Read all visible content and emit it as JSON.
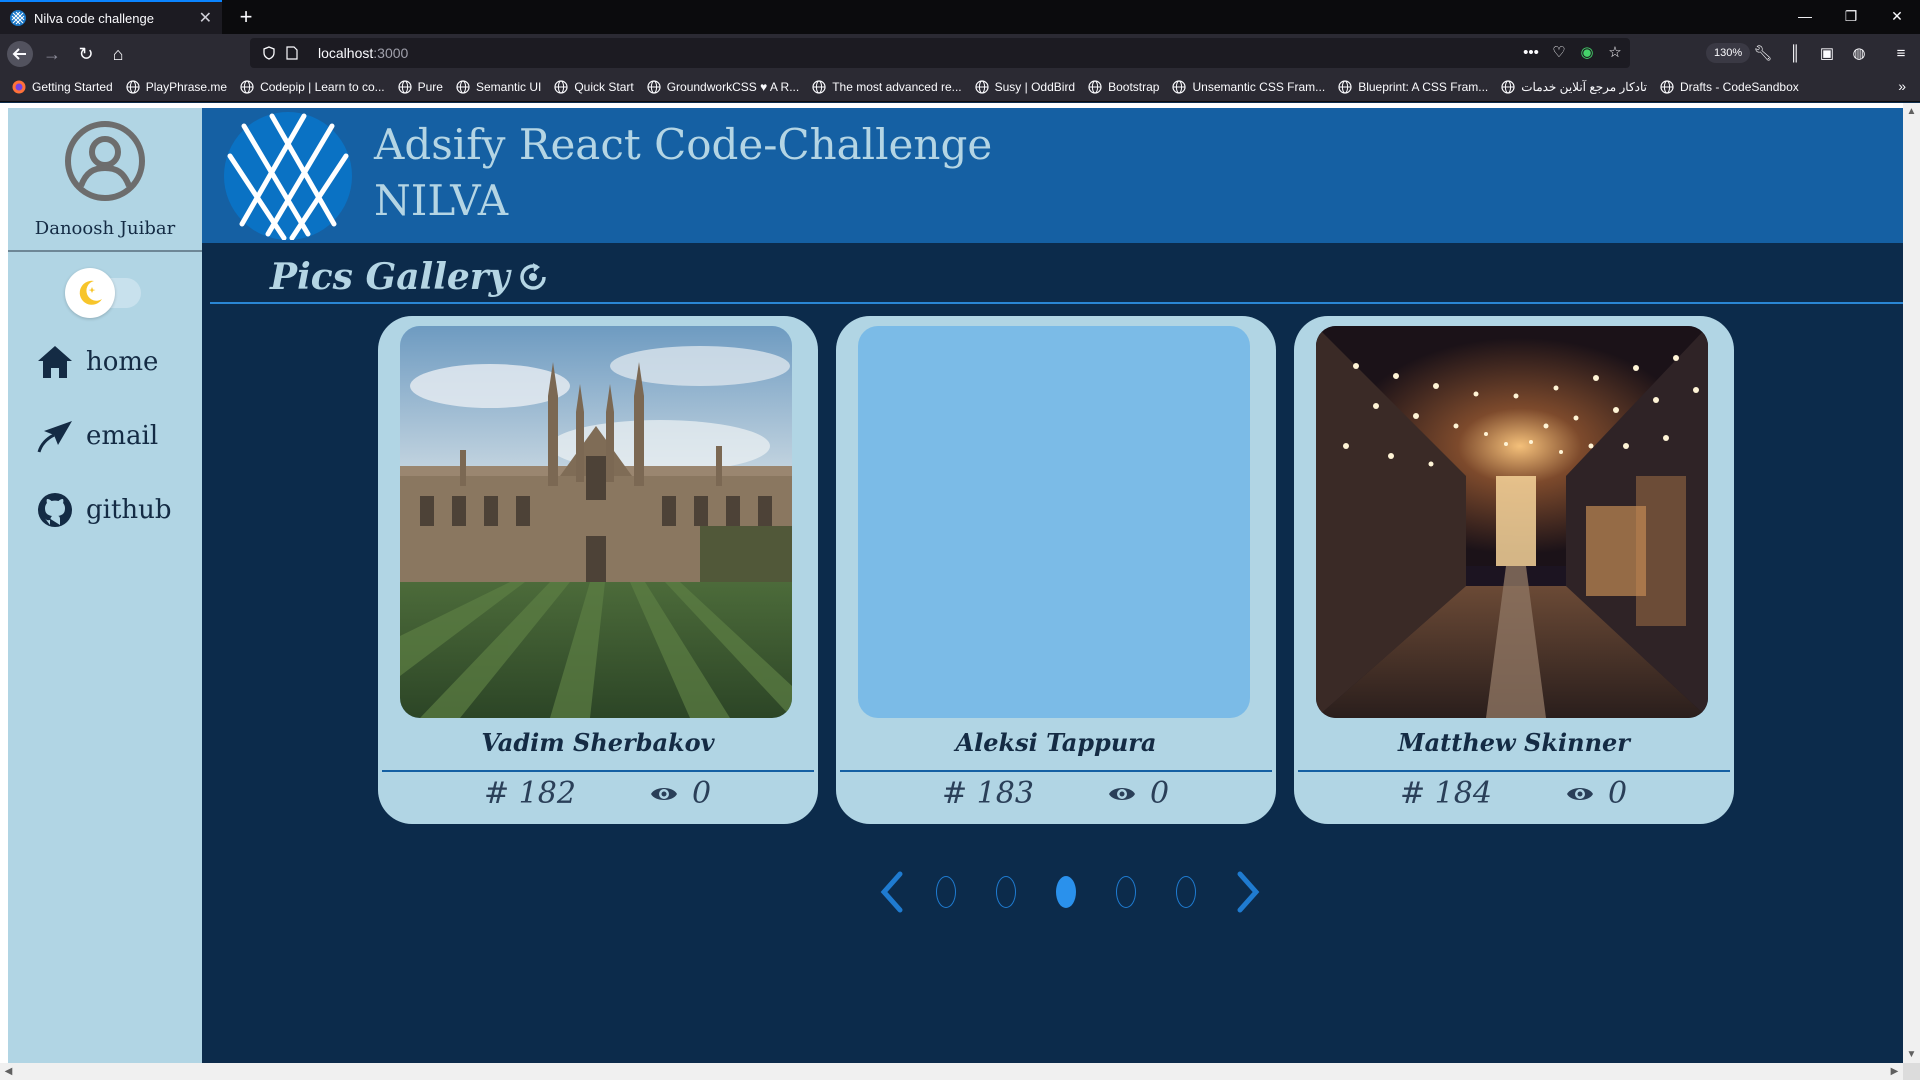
{
  "browser": {
    "tab_title": "Nilva code challenge",
    "url_host": "localhost",
    "url_port": ":3000",
    "zoom": "130%",
    "bookmarks": [
      "Getting Started",
      "PlayPhrase.me",
      "Codepip | Learn to co...",
      "Pure",
      "Semantic UI",
      "Quick Start",
      "GroundworkCSS ♥ A R...",
      "The most advanced re...",
      "Susy | OddBird",
      "Bootstrap",
      "Unsemantic CSS Fram...",
      "Blueprint: A CSS Fram...",
      "تادکار مرجع آنلاین خدمات",
      "Drafts - CodeSandbox"
    ]
  },
  "sidebar": {
    "user_name": "Danoosh Juibar",
    "nav": [
      {
        "label": "home",
        "icon": "home-icon"
      },
      {
        "label": "email",
        "icon": "send-icon"
      },
      {
        "label": "github",
        "icon": "github-icon"
      }
    ]
  },
  "header": {
    "title_line1": "Adsify React Code-Challenge",
    "title_line2": "NILVA"
  },
  "gallery": {
    "title": "Pics Gallery",
    "cards": [
      {
        "author": "Vadim Sherbakov",
        "id": "# 182",
        "views": "0",
        "image": "college-building"
      },
      {
        "author": "Aleksi Tappura",
        "id": "# 183",
        "views": "0",
        "image": "placeholder-loading"
      },
      {
        "author": "Matthew Skinner",
        "id": "# 184",
        "views": "0",
        "image": "night-street-lights"
      }
    ]
  },
  "pagination": {
    "total_pages": 5,
    "current_page": 3
  },
  "colors": {
    "sidebar": "#b1d5e4",
    "header": "#1560a3",
    "background": "#0c2b4b",
    "accent": "#2a91ec"
  }
}
